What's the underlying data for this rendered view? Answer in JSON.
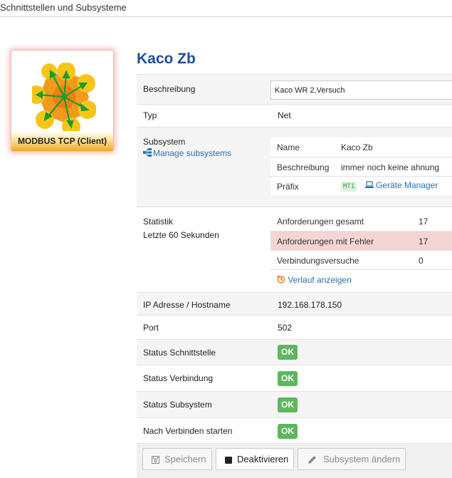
{
  "page": {
    "title": "Schnittstellen und Subsysteme"
  },
  "card": {
    "caption": "MODBUS TCP (Client)"
  },
  "header": {
    "title": "Kaco Zb"
  },
  "fields": {
    "beschreibung_label": "Beschreibung",
    "beschreibung_value": "Kaco WR 2.Versuch",
    "typ_label": "Typ",
    "typ_value": "Net",
    "subsystem_label": "Subsystem",
    "manage_link": "Manage subsystems",
    "statistik_label": "Statistik",
    "statistik_sub": "Letzte 60 Sekunden",
    "ip_label": "IP Adresse / Hostname",
    "ip_value": "192.168.178.150",
    "port_label": "Port",
    "port_value": "502",
    "status_schnitt_label": "Status Schnittstelle",
    "status_verb_label": "Status Verbindung",
    "status_sub_label": "Status Subsystem",
    "nach_verb_label": "Nach Verbinden starten",
    "ok_label": "OK"
  },
  "subsystem": {
    "name_label": "Name",
    "name_value": "Kaco Zb",
    "beschreibung_label": "Beschreibung",
    "beschreibung_value": "immer noch keine ahnung",
    "praefix_label": "Präfix",
    "praefix_tag": "MT1",
    "geraete_link": "Geräte Manager"
  },
  "statistik": {
    "anf_gesamt_label": "Anforderungen gesamt",
    "anf_gesamt_value": "17",
    "anf_fehler_label": "Anforderungen mit Fehler",
    "anf_fehler_value": "17",
    "verb_label": "Verbindungsversuche",
    "verb_value": "0",
    "verlauf_link": "Verlauf anzeigen"
  },
  "buttons": {
    "save": "Speichern",
    "deactivate": "Deaktivieren",
    "change": "Subsystem ändern"
  },
  "colors": {
    "accent": "#1d4ea0",
    "ok": "#5cb85c",
    "error_bg": "#f5d4d4",
    "link": "#2a6fb5"
  }
}
